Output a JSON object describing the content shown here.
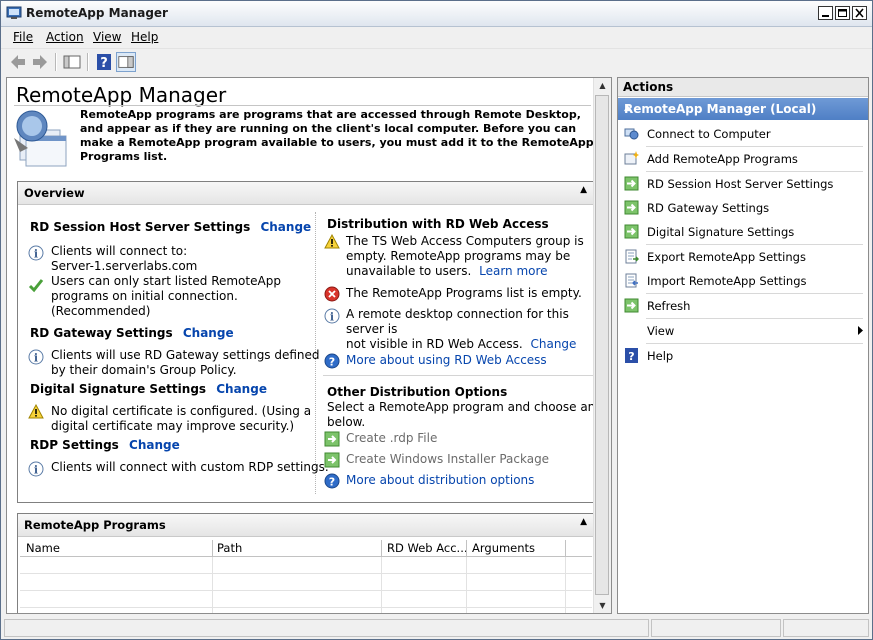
{
  "window": {
    "title": "RemoteApp Manager"
  },
  "menu": [
    {
      "label": "File"
    },
    {
      "label": "Action"
    },
    {
      "label": "View"
    },
    {
      "label": "Help"
    }
  ],
  "center": {
    "title": "RemoteApp Manager",
    "intro": "RemoteApp programs are programs that are accessed through Remote Desktop, and appear as if they are running on the client's local computer. Before you can make a RemoteApp program available to users, you must add it to the RemoteApp Programs list.",
    "overview": {
      "title": "Overview",
      "session_host": {
        "heading": "RD Session Host Server Settings",
        "change": "Change",
        "info1_line1": "Clients will connect to:",
        "info1_line2": "Server-1.serverlabs.com",
        "ok_line1": "Users can only start listed RemoteApp",
        "ok_line2": "programs on initial connection.",
        "ok_line3": "(Recommended)"
      },
      "gateway": {
        "heading": "RD Gateway Settings",
        "change": "Change",
        "line1": "Clients will use RD Gateway settings defined",
        "line2": "by their domain's Group Policy."
      },
      "signature": {
        "heading": "Digital Signature Settings",
        "change": "Change",
        "line1": "No digital certificate is configured. (Using a",
        "line2": "digital certificate may improve security.)"
      },
      "rdp": {
        "heading": "RDP Settings",
        "change": "Change",
        "line1": "Clients will connect with custom RDP settings."
      },
      "webaccess": {
        "heading": "Distribution with RD Web Access",
        "warn_line1": "The TS Web Access Computers group is",
        "warn_line2": "empty. RemoteApp programs may be",
        "warn_line3": "unavailable to users.",
        "learn_more": "Learn more",
        "error": "The RemoteApp Programs list is empty.",
        "info_line1": "A remote desktop connection for this server is",
        "info_line2": "not visible in RD Web Access.",
        "change": "Change",
        "more": "More about using RD Web Access"
      },
      "other": {
        "heading": "Other Distribution Options",
        "line1": "Select a RemoteApp program and choose an optio",
        "line2": "below.",
        "rdp_file": "Create .rdp File",
        "msi": "Create Windows Installer Package",
        "more": "More about distribution options"
      }
    },
    "programs": {
      "title": "RemoteApp Programs",
      "columns": [
        "Name",
        "Path",
        "RD Web Acc...",
        "Arguments"
      ]
    }
  },
  "actions": {
    "header": "Actions",
    "section": "RemoteApp Manager (Local)",
    "items": [
      {
        "label": "Connect to Computer",
        "icon": "connect-icon"
      },
      {
        "label": "Add RemoteApp Programs",
        "icon": "add-program-icon"
      },
      {
        "label": "RD Session Host Server Settings",
        "icon": "green-arrow-icon"
      },
      {
        "label": "RD Gateway Settings",
        "icon": "green-arrow-icon"
      },
      {
        "label": "Digital Signature Settings",
        "icon": "green-arrow-icon"
      },
      {
        "label": "Export RemoteApp Settings",
        "icon": "export-icon"
      },
      {
        "label": "Import RemoteApp Settings",
        "icon": "import-icon"
      },
      {
        "label": "Refresh",
        "icon": "refresh-icon"
      },
      {
        "label": "View",
        "icon": ""
      },
      {
        "label": "Help",
        "icon": "help-icon"
      }
    ]
  }
}
